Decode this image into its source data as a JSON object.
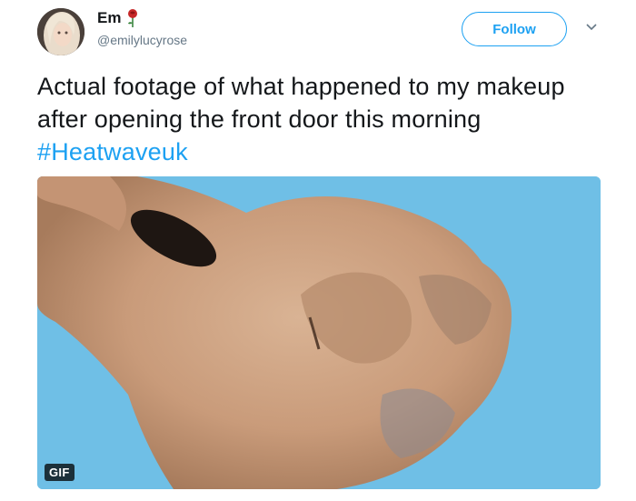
{
  "author": {
    "display_name": "Em",
    "handle": "@emilylucyrose",
    "name_emoji": "rose-icon"
  },
  "actions": {
    "follow_label": "Follow",
    "menu_icon": "chevron-down-icon"
  },
  "tweet": {
    "text": "Actual footage of what happened to my makeup after opening the front door this morning ",
    "hashtag": "#Heatwaveuk"
  },
  "media": {
    "badge": "GIF"
  },
  "colors": {
    "accent": "#1da1f2",
    "secondary_text": "#657786",
    "media_background": "#6fbfe6"
  }
}
